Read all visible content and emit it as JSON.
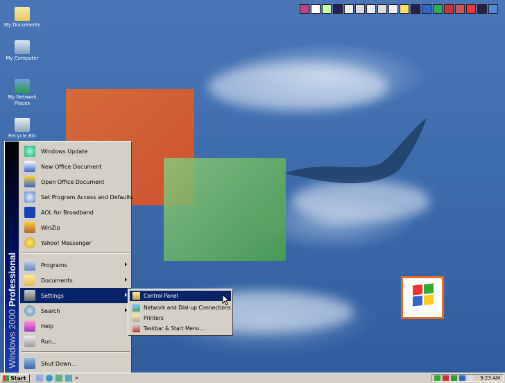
{
  "desktop": {
    "icons": [
      {
        "label": "My Documents",
        "icon": "folder-documents-icon"
      },
      {
        "label": "My Computer",
        "icon": "computer-icon"
      },
      {
        "label": "My Network Places",
        "icon": "network-places-icon"
      },
      {
        "label": "Recycle Bin",
        "icon": "recycle-bin-icon"
      }
    ]
  },
  "start_menu": {
    "banner": {
      "part1": "Windows 2000 ",
      "part2": "Professional"
    },
    "items": [
      {
        "label": "Windows Update",
        "icon": "windows-update-icon"
      },
      {
        "label": "New Office Document",
        "icon": "new-office-doc-icon"
      },
      {
        "label": "Open Office Document",
        "icon": "open-office-doc-icon"
      },
      {
        "label": "Set Program Access and Defaults",
        "icon": "program-access-icon"
      },
      {
        "label": "AOL for Broadband",
        "icon": "aol-icon"
      },
      {
        "label": "WinZip",
        "icon": "winzip-icon"
      },
      {
        "label": "Yahoo! Messenger",
        "icon": "yahoo-messenger-icon"
      },
      {
        "label": "Programs",
        "icon": "programs-icon"
      },
      {
        "label": "Documents",
        "icon": "documents-icon"
      },
      {
        "label": "Settings",
        "icon": "settings-icon"
      },
      {
        "label": "Search",
        "icon": "search-icon"
      },
      {
        "label": "Help",
        "icon": "help-icon"
      },
      {
        "label": "Run...",
        "icon": "run-icon"
      },
      {
        "label": "Shut Down...",
        "icon": "shut-down-icon"
      }
    ]
  },
  "settings_submenu": {
    "items": [
      {
        "label": "Control Panel",
        "icon": "control-panel-icon"
      },
      {
        "label": "Network and Dial-up Connections",
        "icon": "network-connections-icon"
      },
      {
        "label": "Printers",
        "icon": "printers-icon"
      },
      {
        "label": "Taskbar & Start Menu...",
        "icon": "taskbar-start-menu-icon"
      }
    ]
  },
  "taskbar": {
    "start_label": "Start",
    "quicklaunch_more": "»",
    "clock": "9:23 AM"
  },
  "colors": {
    "highlight": "#0a246a",
    "menu_bg": "#d4d0c8",
    "desktop": "#3e6dae"
  }
}
